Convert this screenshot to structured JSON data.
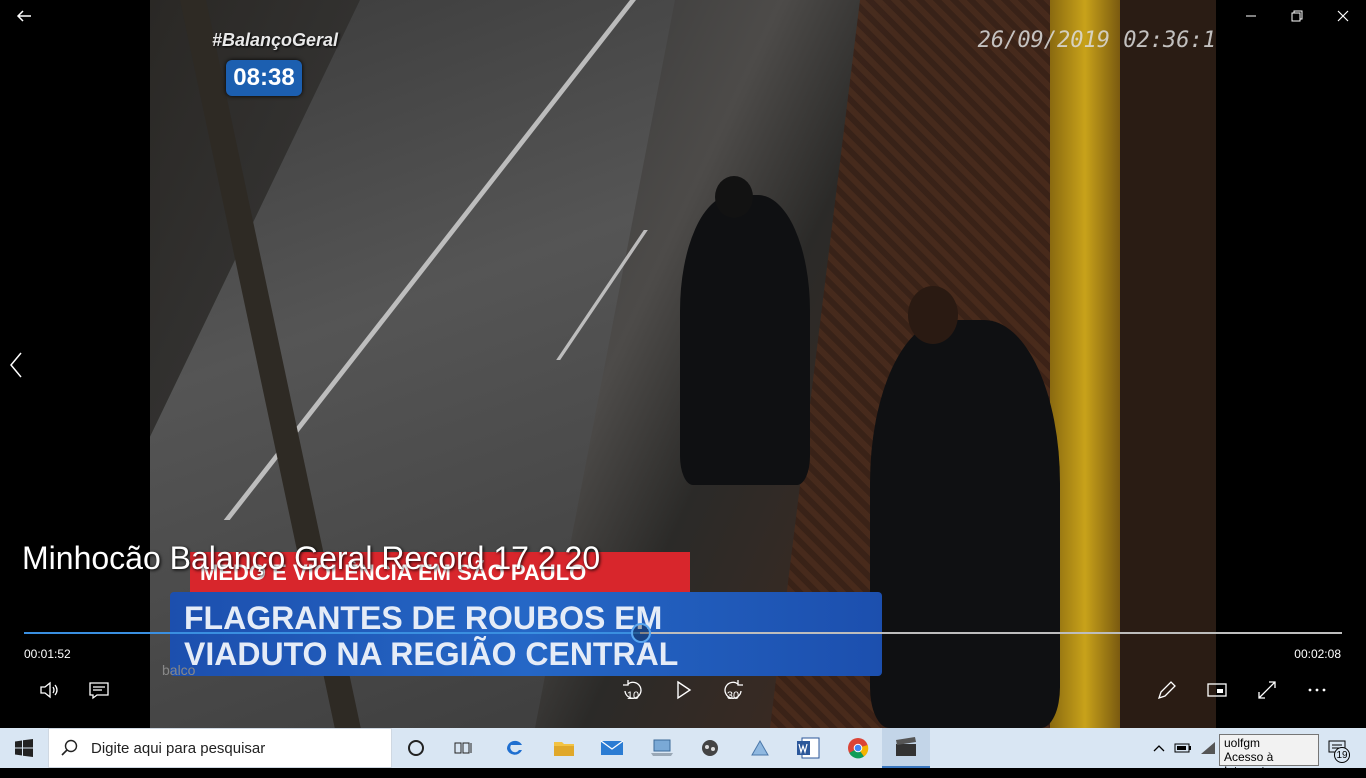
{
  "video": {
    "hashtag": "#BalançoGeral",
    "clock": "08:38",
    "camera_timestamp": "26/09/2019 02:36:1",
    "ticker_red": "MEDO E VIOLÊNCIA EM SÃO PAULO",
    "ticker_blue_line1": "FLAGRANTES DE ROUBOS EM",
    "ticker_blue_line2": "VIADUTO NA REGIÃO CENTRAL",
    "ticker_brand": "balco"
  },
  "player": {
    "title": "Minhocão Balanço Geral Record 17 2 20",
    "elapsed": "00:01:52",
    "duration": "00:02:08",
    "progress_fraction": 0.467,
    "skip_back_label": "10",
    "skip_forward_label": "30",
    "accent": "#3a8fe0",
    "icons": {
      "back": "arrow-left-icon",
      "minimize": "minimize-icon",
      "restore": "restore-icon",
      "close": "close-icon",
      "previous": "chevron-left-icon",
      "volume": "volume-icon",
      "captions": "captions-icon",
      "skip_back": "skip-back-10-icon",
      "play": "play-icon",
      "skip_forward": "skip-forward-30-icon",
      "edit": "pencil-icon",
      "mini_view": "mini-view-icon",
      "fullscreen": "fullscreen-icon",
      "more": "more-icon"
    }
  },
  "taskbar": {
    "search_placeholder": "Digite aqui para pesquisar",
    "tooltip_line1": "uolfgm",
    "tooltip_line2": "Acesso à Internet",
    "notifications_count": "19",
    "apps": [
      "cortana",
      "task-view",
      "edge",
      "file-explorer",
      "mail",
      "computer",
      "game",
      "network-app",
      "word",
      "chrome",
      "movies-tv"
    ]
  }
}
